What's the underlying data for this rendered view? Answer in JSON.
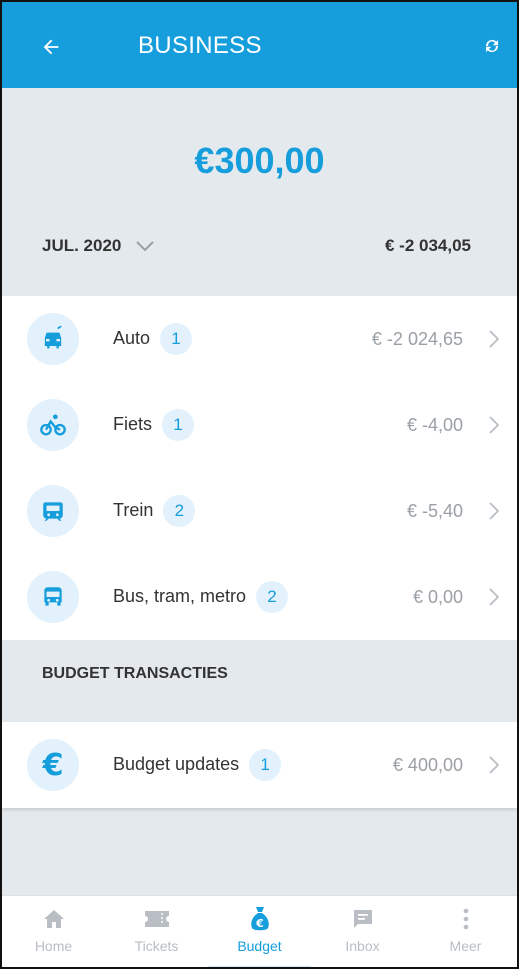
{
  "header": {
    "title": "BUSINESS",
    "back_icon": "arrow-left-icon",
    "refresh_icon": "refresh-icon",
    "color": "#169ddc"
  },
  "summary": {
    "amount": "€300,00",
    "period": "JUL. 2020",
    "period_total": "€ -2 034,05"
  },
  "categories": [
    {
      "label": "Auto",
      "count": "1",
      "amount": "€ -2 024,65",
      "icon": "car-icon"
    },
    {
      "label": "Fiets",
      "count": "1",
      "amount": "€ -4,00",
      "icon": "bicycle-icon"
    },
    {
      "label": "Trein",
      "count": "2",
      "amount": "€ -5,40",
      "icon": "train-icon"
    },
    {
      "label": "Bus, tram, metro",
      "count": "2",
      "amount": "€ 0,00",
      "icon": "bus-icon"
    }
  ],
  "budget_section": {
    "title": "BUDGET TRANSACTIES",
    "items": [
      {
        "label": "Budget updates",
        "count": "1",
        "amount": "€ 400,00",
        "icon": "euro-icon"
      }
    ]
  },
  "bottom_nav": {
    "items": [
      {
        "label": "Home",
        "icon": "home-icon",
        "active": false
      },
      {
        "label": "Tickets",
        "icon": "ticket-icon",
        "active": false
      },
      {
        "label": "Budget",
        "icon": "money-bag-icon",
        "active": true
      },
      {
        "label": "Inbox",
        "icon": "message-icon",
        "active": false
      },
      {
        "label": "Meer",
        "icon": "more-vertical-icon",
        "active": false
      }
    ]
  },
  "colors": {
    "accent": "#169ddc",
    "background": "#e4e9ed",
    "icon_circle": "#e2f1fb",
    "muted": "#9aa0a6"
  }
}
